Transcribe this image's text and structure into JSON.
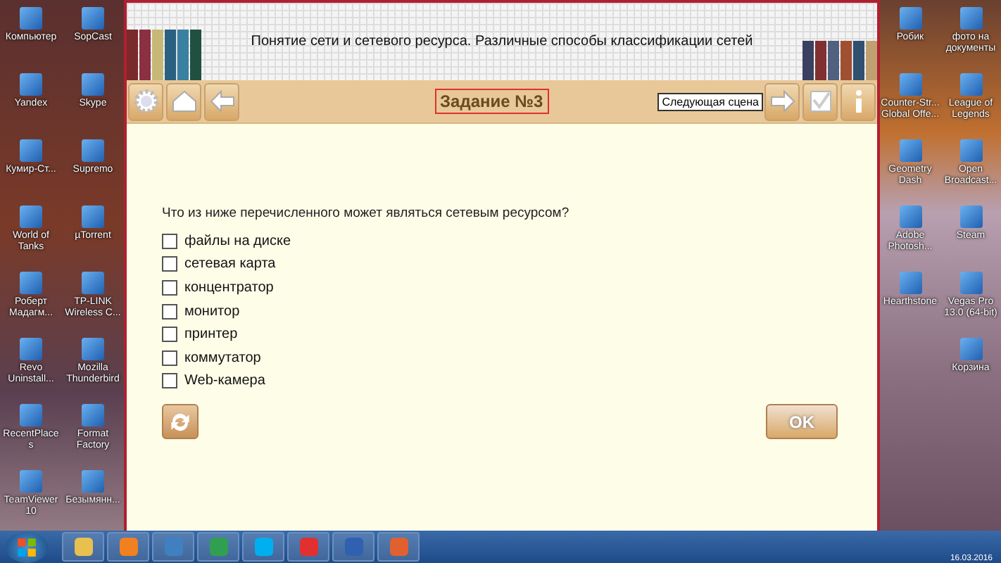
{
  "desktop_left": [
    {
      "label": "Компьютер"
    },
    {
      "label": "SopCast"
    },
    {
      "label": "Yandex"
    },
    {
      "label": "Skype"
    },
    {
      "label": "Кумир-Ст..."
    },
    {
      "label": "Supremo"
    },
    {
      "label": "World of Tanks"
    },
    {
      "label": "µTorrent"
    },
    {
      "label": "Роберт Мадагм..."
    },
    {
      "label": "TP-LINK Wireless C..."
    },
    {
      "label": "Revo Uninstall..."
    },
    {
      "label": "Mozilla Thunderbird"
    },
    {
      "label": "RecentPlaces"
    },
    {
      "label": "Format Factory"
    },
    {
      "label": "TeamViewer 10"
    },
    {
      "label": "Безымянн..."
    }
  ],
  "desktop_right": [
    {
      "label": "Робик"
    },
    {
      "label": "фото на документы"
    },
    {
      "label": "Counter-Str... Global Offe..."
    },
    {
      "label": "League of Legends"
    },
    {
      "label": "Geometry Dash"
    },
    {
      "label": "Open Broadcast..."
    },
    {
      "label": "Adobe Photosh..."
    },
    {
      "label": "Steam"
    },
    {
      "label": "Hearthstone"
    },
    {
      "label": "Vegas Pro 13.0 (64-bit)"
    },
    {
      "label": "Корзина"
    }
  ],
  "window": {
    "title": "Понятие сети и сетевого ресурса. Различные способы классификации сетей",
    "task_title": "Задание №3",
    "next_tooltip": "Следующая сцена",
    "question": "Что из ниже перечисленного может являться сетевым ресурсом?",
    "options": [
      {
        "label": "файлы на диске",
        "checked": false
      },
      {
        "label": "сетевая карта",
        "checked": false
      },
      {
        "label": "концентратор",
        "checked": false
      },
      {
        "label": "монитор",
        "checked": false
      },
      {
        "label": "принтер",
        "checked": false
      },
      {
        "label": "коммутатор",
        "checked": false
      },
      {
        "label": "Web-камера",
        "checked": false
      }
    ],
    "ok_button": "OK"
  },
  "taskbar": {
    "date": "16.03.2016"
  }
}
